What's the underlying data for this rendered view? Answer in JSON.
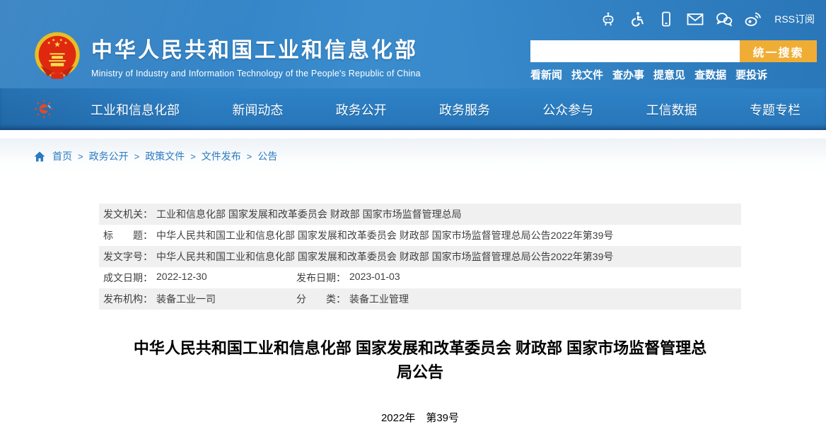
{
  "header": {
    "site_title": "中华人民共和国工业和信息化部",
    "site_subtitle": "Ministry of Industry and Information Technology of the People's Republic of China",
    "top_icons": [
      "robot-assistant",
      "accessibility",
      "mobile",
      "mail",
      "wechat",
      "weibo"
    ],
    "rss_label": "RSS订阅",
    "search": {
      "value": "",
      "placeholder": "",
      "button_label": "统一搜索"
    },
    "quick_links": [
      "看新闻",
      "找文件",
      "查办事",
      "提意见",
      "查数据",
      "要投诉"
    ]
  },
  "nav": {
    "items": [
      "工业和信息化部",
      "新闻动态",
      "政务公开",
      "政务服务",
      "公众参与",
      "工信数据",
      "专题专栏"
    ]
  },
  "breadcrumb": {
    "separator": ">",
    "items": [
      "首页",
      "政务公开",
      "政策文件",
      "文件发布",
      "公告"
    ]
  },
  "meta_table": {
    "rows": [
      {
        "label": "发文机关：",
        "value": "工业和信息化部 国家发展和改革委员会 财政部 国家市场监督管理总局"
      },
      {
        "label": "标　　题：",
        "value": "中华人民共和国工业和信息化部 国家发展和改革委员会 财政部 国家市场监督管理总局公告2022年第39号"
      },
      {
        "label": "发文字号：",
        "value": "中华人民共和国工业和信息化部 国家发展和改革委员会 财政部 国家市场监督管理总局公告2022年第39号"
      },
      {
        "label": "成文日期：",
        "value": "2022-12-30",
        "label2": "发布日期：",
        "value2": "2023-01-03"
      },
      {
        "label": "发布机构：",
        "value": "装备工业一司",
        "label2": "分　　类：",
        "value2": "装备工业管理"
      }
    ]
  },
  "article": {
    "title": "中华人民共和国工业和信息化部 国家发展和改革委员会 财政部 国家市场监督管理总局公告",
    "doc_number": "2022年　第39号"
  },
  "colors": {
    "header_blue": "#2e80c3",
    "nav_blue": "#2877ba",
    "accent_orange": "#f0ad35",
    "link_blue": "#2b7ac0",
    "row_gray": "#f0f0f0",
    "emblem_gold": "#e9be24",
    "emblem_red": "#de2910"
  }
}
